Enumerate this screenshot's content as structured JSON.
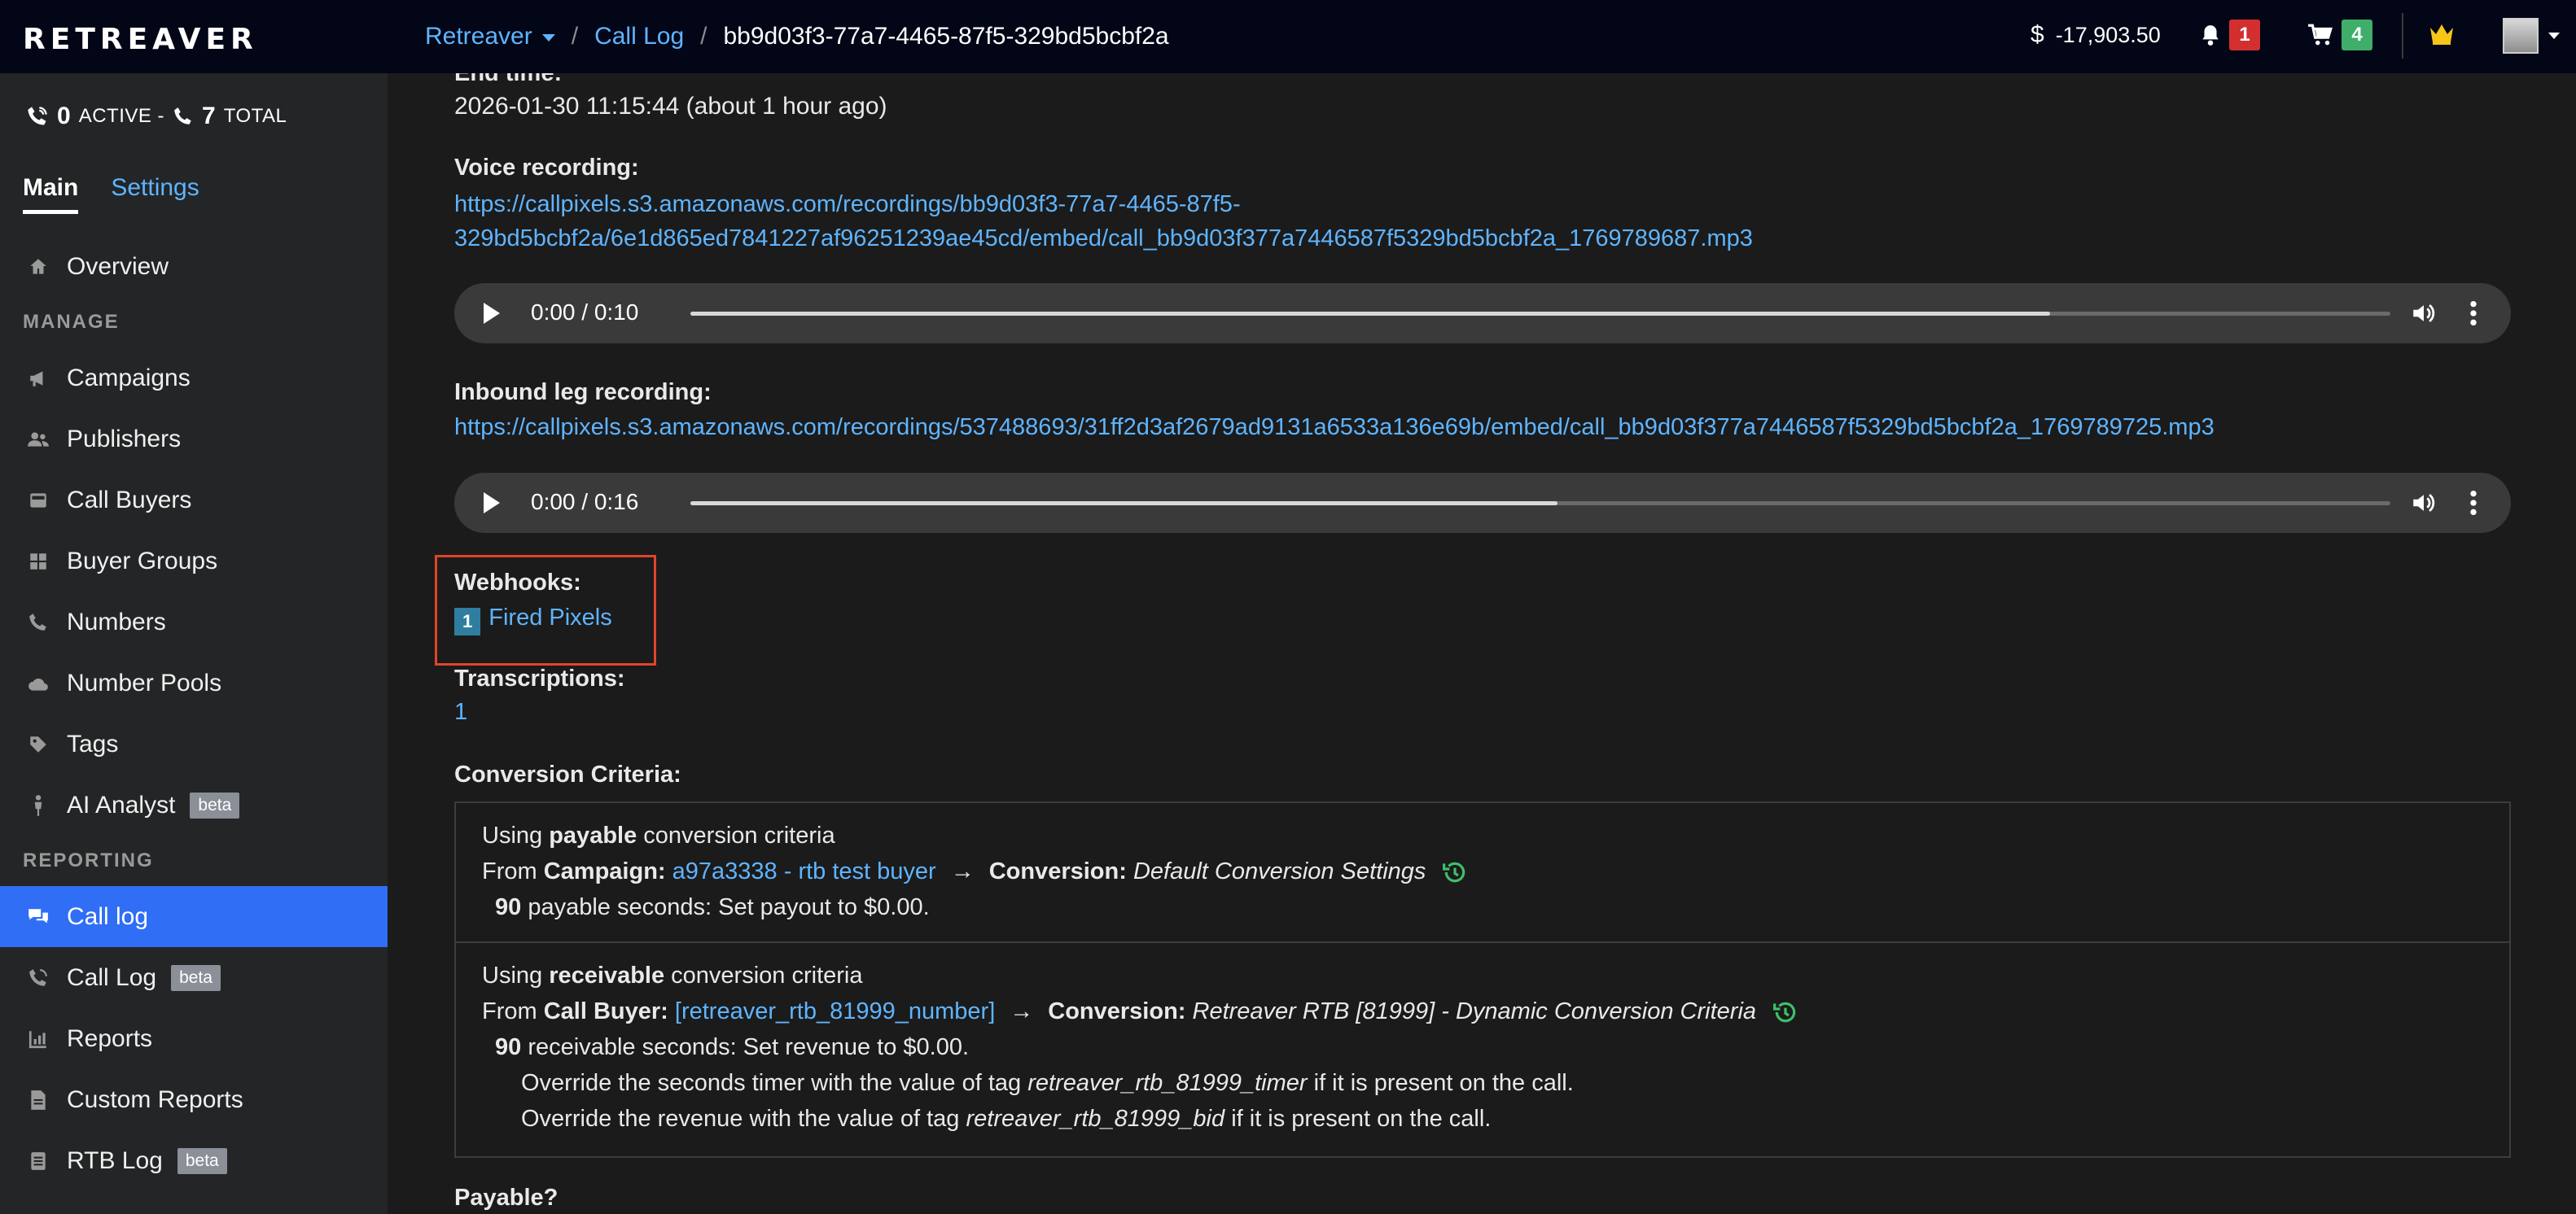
{
  "topbar": {
    "logo": "RETREAVER",
    "crumb_account": "Retreaver",
    "crumb_section": "Call Log",
    "crumb_current": "bb9d03f3-77a7-4465-87f5-329bd5bcbf2a",
    "balance_symbol": "$",
    "balance": "-17,903.50",
    "notifications_count": "1",
    "cart_count": "4"
  },
  "sidebar": {
    "active_count": "0",
    "active_label": "ACTIVE -",
    "total_count": "7",
    "total_label": "TOTAL",
    "tab_main": "Main",
    "tab_settings": "Settings",
    "overview": "Overview",
    "section_manage": "MANAGE",
    "campaigns": "Campaigns",
    "publishers": "Publishers",
    "call_buyers": "Call Buyers",
    "buyer_groups": "Buyer Groups",
    "numbers": "Numbers",
    "number_pools": "Number Pools",
    "tags": "Tags",
    "ai_analyst": "AI Analyst",
    "section_reporting": "REPORTING",
    "call_log": "Call log",
    "call_log_beta": "Call Log",
    "reports": "Reports",
    "custom_reports": "Custom Reports",
    "rtb_log": "RTB Log",
    "beta": "beta"
  },
  "detail": {
    "end_time_label": "End time:",
    "end_time_value": "2026-01-30 11:15:44 (about 1 hour ago)",
    "voice_label": "Voice recording:",
    "voice_url_1": "https://callpixels.s3.amazonaws.com/recordings/bb9d03f3-77a7-4465-87f5-",
    "voice_url_2": "329bd5bcbf2a/6e1d865ed7841227af96251239ae45cd/embed/call_bb9d03f377a7446587f5329bd5bcbf2a_1769789687.mp3",
    "voice_player_time": "0:00 / 0:10",
    "voice_player_progress": 0.8,
    "inbound_label": "Inbound leg recording:",
    "inbound_url": "https://callpixels.s3.amazonaws.com/recordings/537488693/31ff2d3af2679ad9131a6533a136e69b/embed/call_bb9d03f377a7446587f5329bd5bcbf2a_1769789725.mp3",
    "inbound_player_time": "0:00 / 0:16",
    "inbound_player_progress": 0.51,
    "webhooks_label": "Webhooks:",
    "fired_pixels_count": "1",
    "fired_pixels_label": "Fired Pixels",
    "transcriptions_label": "Transcriptions:",
    "transcriptions_value": "1",
    "conversion_label": "Conversion Criteria:",
    "payable_label": "Payable?"
  },
  "criteria": {
    "payable": {
      "using": "Using",
      "type": "payable",
      "rest": "conversion criteria",
      "from": "From",
      "source_label": "Campaign:",
      "source_value": "a97a3338 - rtb test buyer",
      "arrow": "→",
      "conversion_label": "Conversion:",
      "conversion_value": "Default Conversion Settings",
      "seconds": "90",
      "seconds_text": "payable seconds: Set payout to $0.00."
    },
    "receivable": {
      "using": "Using",
      "type": "receivable",
      "rest": "conversion criteria",
      "from": "From",
      "source_label": "Call Buyer:",
      "source_value": "[retreaver_rtb_81999_number]",
      "arrow": "→",
      "conversion_label": "Conversion:",
      "conversion_value": "Retreaver RTB [81999] - Dynamic Conversion Criteria",
      "seconds": "90",
      "seconds_text": "receivable seconds: Set revenue to $0.00.",
      "override1_a": "Override the seconds timer with the value of tag",
      "override1_tag": "retreaver_rtb_81999_timer",
      "override1_b": "if it is present on the call.",
      "override2_a": "Override the revenue with the value of tag",
      "override2_tag": "retreaver_rtb_81999_bid",
      "override2_b": "if it is present on the call."
    }
  },
  "colors": {
    "accent_link": "#5fb4ff",
    "active_nav": "#2f6ef5",
    "highlight_box": "#e0442c",
    "history_icon": "#3fbf6a"
  }
}
